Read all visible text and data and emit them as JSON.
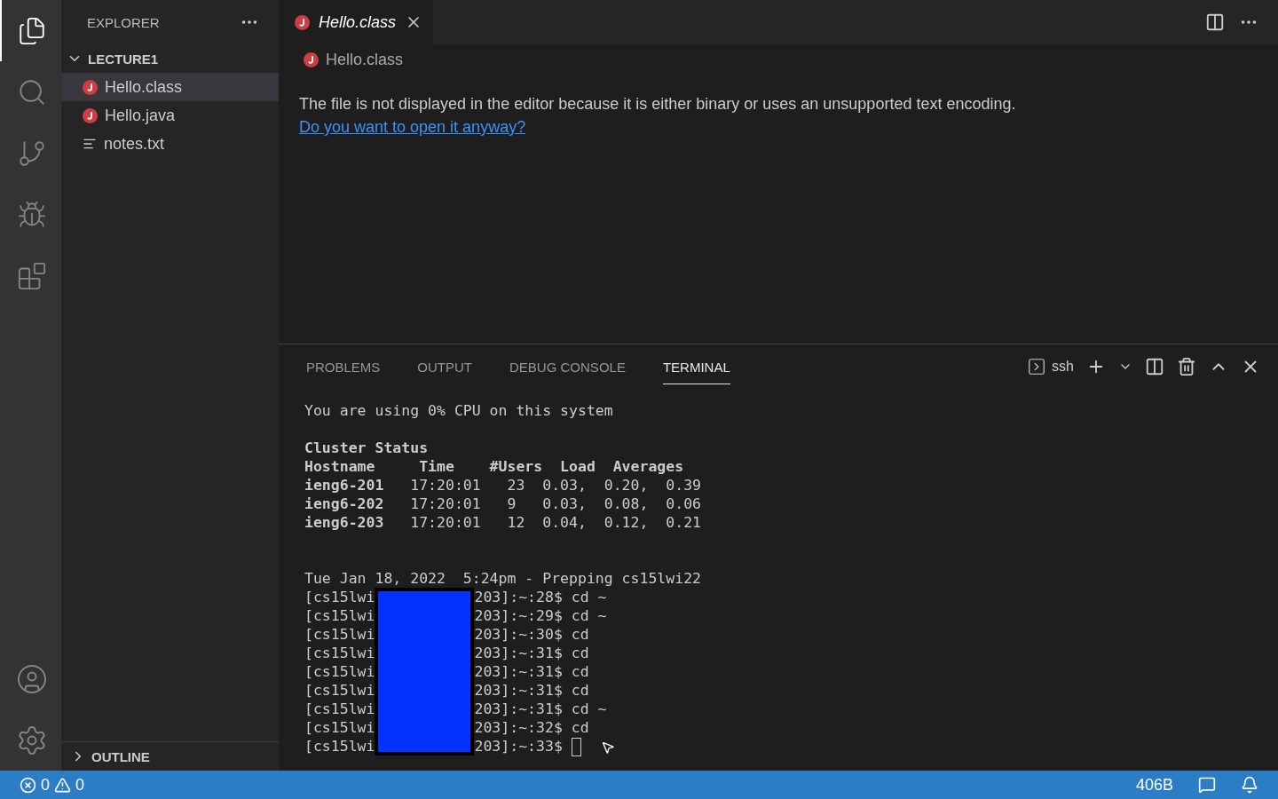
{
  "activity_bar": [
    {
      "selected": true
    },
    {
      "selected": false
    },
    {
      "selected": false
    },
    {
      "selected": false
    },
    {
      "selected": false
    }
  ],
  "sidebar": {
    "title": "EXPLORER",
    "folder": {
      "name": "LECTURE1",
      "expanded": true,
      "children": [
        {
          "name": "Hello.class",
          "kind": "java",
          "selected": true
        },
        {
          "name": "Hello.java",
          "kind": "java",
          "selected": false
        },
        {
          "name": "notes.txt",
          "kind": "text",
          "selected": false
        }
      ]
    },
    "outline": {
      "name": "OUTLINE",
      "expanded": false
    }
  },
  "tabs": [
    {
      "label": "Hello.class",
      "kind": "java",
      "selected": true
    }
  ],
  "breadcrumb": {
    "label": "Hello.class",
    "kind": "java"
  },
  "message": {
    "text": "The file is not displayed in the editor because it is either binary or uses an unsupported text encoding.",
    "link": "Do you want to open it anyway?"
  },
  "panel": {
    "tabs": [
      {
        "label": "PROBLEMS",
        "selected": false
      },
      {
        "label": "OUTPUT",
        "selected": false
      },
      {
        "label": "DEBUG CONSOLE",
        "selected": false
      },
      {
        "label": "TERMINAL",
        "selected": true
      }
    ],
    "terminal_name": "ssh",
    "lines": [
      {
        "kind": "text",
        "text": "You are using 0% CPU on this system"
      },
      {
        "kind": "blank"
      },
      {
        "kind": "text",
        "text": "**Cluster Status**"
      },
      {
        "kind": "text",
        "text": "**Hostname     Time    #Users  Load  Averages**"
      },
      {
        "kind": "text",
        "text": "**ieng6-201**   17:20:01   23  0.03,  0.20,  0.39"
      },
      {
        "kind": "text",
        "text": "**ieng6-202**   17:20:01   9   0.03,  0.08,  0.06"
      },
      {
        "kind": "text",
        "text": "**ieng6-203**   17:20:01   12  0.04,  0.12,  0.21"
      },
      {
        "kind": "blank"
      },
      {
        "kind": "blank"
      },
      {
        "kind": "text",
        "text": "Tue Jan 18, 2022  5:24pm - Prepping cs15lwi22"
      }
    ],
    "prompts": [
      {
        "before": "[cs15lwi",
        "after": "203]:~:28$ cd ~",
        "cursor": false
      },
      {
        "before": "[cs15lwi",
        "after": "203]:~:29$ cd ~",
        "cursor": false
      },
      {
        "before": "[cs15lwi",
        "after": "203]:~:30$ cd",
        "cursor": false
      },
      {
        "before": "[cs15lwi",
        "after": "203]:~:31$ cd",
        "cursor": false
      },
      {
        "before": "[cs15lwi",
        "after": "203]:~:31$ cd",
        "cursor": false
      },
      {
        "before": "[cs15lwi",
        "after": "203]:~:31$ cd",
        "cursor": false
      },
      {
        "before": "[cs15lwi",
        "after": "203]:~:31$ cd ~",
        "cursor": false
      },
      {
        "before": "[cs15lwi",
        "after": "203]:~:32$ cd",
        "cursor": false
      },
      {
        "before": "[cs15lwi",
        "after": "203]:~:33$",
        "cursor": true
      }
    ]
  },
  "status_bar": {
    "errors": "0",
    "warnings": "0",
    "size": "406B"
  }
}
